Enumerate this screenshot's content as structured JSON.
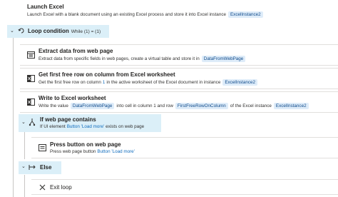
{
  "launch_excel": {
    "title": "Launch Excel",
    "desc": "Launch Excel with a blank document using an existing Excel process and store it into Excel instance",
    "var": "ExcelInstance2"
  },
  "loop": {
    "title": "Loop condition",
    "condition": "While (1) = (1)"
  },
  "extract": {
    "title": "Extract data from web page",
    "desc": "Extract data from specific fields in web pages, create a virtual table and store it in",
    "var": "DataFromWebPage"
  },
  "first_free_row": {
    "title": "Get first free row on column from Excel worksheet",
    "desc_a": "Get the first free row on column",
    "col": "1",
    "desc_b": "in the active worksheet of the Excel document in instance",
    "var": "ExcelInstance2"
  },
  "write_excel": {
    "title": "Write to Excel worksheet",
    "desc_a": "Write the value",
    "value_var": "DataFromWebPage",
    "desc_b": "into cell in column 1 and row",
    "row_var": "FirstFreeRowOnColumn",
    "desc_c": "of the Excel instance",
    "inst_var": "ExcelInstance2"
  },
  "if_web": {
    "title": "If web page contains",
    "desc_a": "If UI element",
    "element": "Button 'Load more'",
    "desc_b": "exists on web page"
  },
  "press_button": {
    "title": "Press button on web page",
    "desc_a": "Press web page button",
    "element": "Button 'Load more'"
  },
  "else": {
    "title": "Else"
  },
  "exit_loop": {
    "title": "Exit loop"
  },
  "colors": {
    "accent_bg": "#dbeff8",
    "pill_bg": "#deecf9",
    "pill_fg": "#0f4a8a"
  }
}
